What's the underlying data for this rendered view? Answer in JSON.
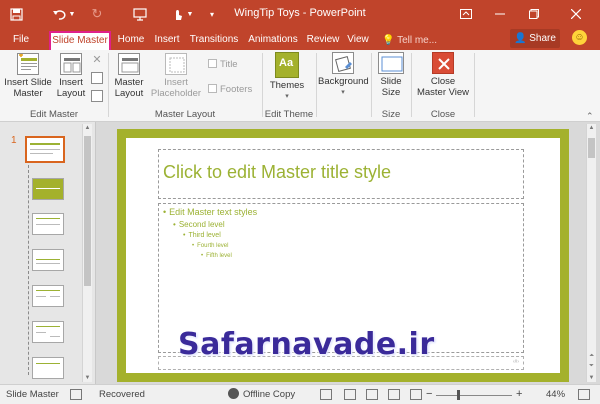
{
  "window": {
    "title": "WingTip Toys - PowerPoint",
    "qat_icons": [
      "save-icon",
      "undo-icon",
      "undo-dropdown-icon",
      "redo-icon",
      "start-from-beginning-icon",
      "touch-mode-icon",
      "touch-dropdown-icon",
      "customize-qat-icon"
    ],
    "controls": [
      "ribbon-display-options-icon",
      "minimize-icon",
      "restore-icon",
      "close-icon"
    ]
  },
  "tabs": {
    "file": "File",
    "slide_master": "Slide Master",
    "home": "Home",
    "insert": "Insert",
    "transitions": "Transitions",
    "animations": "Animations",
    "review": "Review",
    "view": "View",
    "tell_me": "Tell me...",
    "share": "Share",
    "active": "Slide Master"
  },
  "ribbon": {
    "groups": {
      "edit_master": "Edit Master",
      "master_layout": "Master Layout",
      "edit_theme": "Edit Theme",
      "size": "Size",
      "close": "Close"
    },
    "insert_slide_master": [
      "Insert Slide",
      "Master"
    ],
    "insert_layout": [
      "Insert",
      "Layout"
    ],
    "master_layout": [
      "Master",
      "Layout"
    ],
    "insert_placeholder": [
      "Insert",
      "Placeholder"
    ],
    "title_check": "Title",
    "footers_check": "Footers",
    "themes": "Themes",
    "background": "Background",
    "slide_size": [
      "Slide",
      "Size"
    ],
    "close_master_view": [
      "Close",
      "Master View"
    ]
  },
  "thumbnails": {
    "master_number": "1",
    "count": 7
  },
  "slide": {
    "title": "Click to edit Master title style",
    "levels": [
      "Edit Master text styles",
      "Second level",
      "Third level",
      "Fourth level",
      "Fifth level"
    ]
  },
  "watermark": "Safarnavade.ir",
  "status": {
    "view": "Slide Master",
    "recovered": "Recovered",
    "offline": "Offline Copy",
    "zoom_minus": "−",
    "zoom_plus": "+",
    "zoom": "44%"
  },
  "colors": {
    "ribbon_accent": "#c0442b",
    "active_tab_outline": "#e0208a",
    "slide_accent": "#9cb234",
    "slide_border": "#a4b12c",
    "close_button": "#d94c36"
  }
}
